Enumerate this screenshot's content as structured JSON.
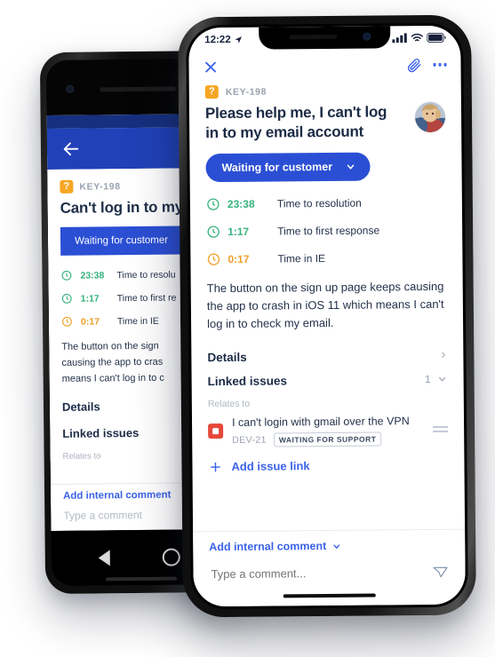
{
  "android": {
    "back_icon": "arrow-left-icon",
    "issue_key": "KEY-198",
    "issue_type_glyph": "?",
    "title": "Can't log in to my em",
    "status_label": "Waiting for customer",
    "sla": [
      {
        "time": "23:38",
        "label": "Time to resolu",
        "color": "#36b37e"
      },
      {
        "time": "1:17",
        "label": "Time to first re",
        "color": "#36b37e"
      },
      {
        "time": "0:17",
        "label": "Time in IE",
        "color": "#f0a029"
      }
    ],
    "description_lines": [
      "The button on the sign ",
      "causing the app to cras",
      "means I can't log in to c"
    ],
    "details_label": "Details",
    "linked_issues_label": "Linked issues",
    "relates_to_label": "Relates to",
    "add_internal_comment": "Add internal comment",
    "comment_placeholder": "Type a comment",
    "nav_back": "nav-back-icon",
    "nav_home": "nav-home-icon"
  },
  "ios": {
    "status_bar": {
      "time": "12:22",
      "location_icon": "location-arrow-icon",
      "signal_icon": "cellular-signal-icon",
      "wifi_icon": "wifi-icon",
      "battery_icon": "battery-icon"
    },
    "topbar": {
      "close_icon": "close-icon",
      "attachment_icon": "paperclip-icon",
      "more_icon": "more-options-icon"
    },
    "issue_key": "KEY-198",
    "issue_type_glyph": "?",
    "title": "Please help me, I can't log in to my email account",
    "status_label": "Waiting for customer",
    "status_chevron": "chevron-down-icon",
    "status_color": "#2b4fd4",
    "sla": [
      {
        "time": "23:38",
        "label": "Time to resolution",
        "color": "#36b37e"
      },
      {
        "time": "1:17",
        "label": "Time to first response",
        "color": "#36b37e"
      },
      {
        "time": "0:17",
        "label": "Time in IE",
        "color": "#f0a029"
      }
    ],
    "description": "The button on the sign up page keeps causing the app to crash in iOS 11 which means I can't log in to check my email.",
    "details": {
      "label": "Details",
      "chevron": ">"
    },
    "linked_issues": {
      "label": "Linked issues",
      "count": "1",
      "chevron": "chevron-down-icon",
      "relates_to_label": "Relates to",
      "items": [
        {
          "title": "I can't login with gmail over the VPN",
          "key": "DEV-21",
          "status": "WAITING FOR SUPPORT",
          "type_color": "#e5493a"
        }
      ],
      "add_link_label": "Add issue link",
      "add_icon": "plus-icon"
    },
    "footer": {
      "add_internal_comment": "Add internal comment",
      "add_internal_chevron": "chevron-down-icon",
      "comment_placeholder": "Type a comment...",
      "send_icon": "send-icon"
    }
  }
}
